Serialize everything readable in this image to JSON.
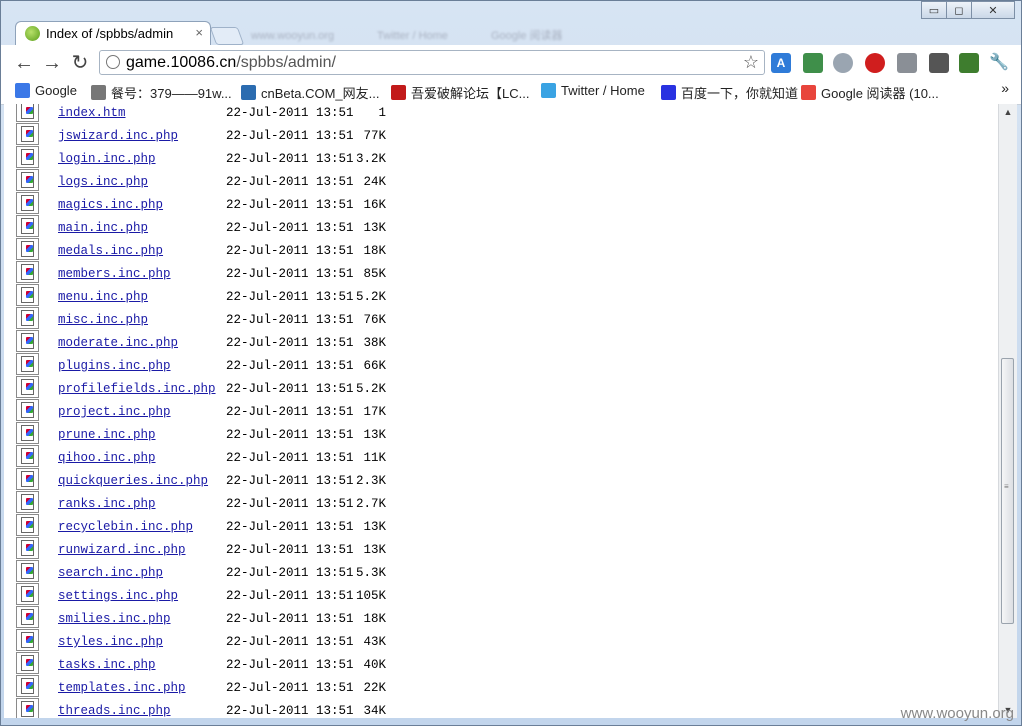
{
  "tab": {
    "title": "Index of /spbbs/admin",
    "close": "×"
  },
  "ghost_tabs": [
    "www.wooyun.org",
    "Twitter / Home",
    "Google 阅读器"
  ],
  "window_controls": {
    "minimize": "▭",
    "maximize": "◻",
    "close": "✕"
  },
  "toolbar": {
    "back": "←",
    "forward": "→",
    "reload": "↻",
    "url_host": "game.10086.cn",
    "url_path": "/spbbs/admin/",
    "star": "☆"
  },
  "bookmarks": [
    {
      "label": "Google",
      "icon": "google-icon",
      "color": "#3b78e7"
    },
    {
      "label": "餐号：379——91w...",
      "icon": "globe-icon",
      "color": "#777777"
    },
    {
      "label": "cnBeta.COM_网友...",
      "icon": "cnbeta-icon",
      "color": "#2b6cb0"
    },
    {
      "label": "吾爱破解论坛【LC...",
      "icon": "52pojie-icon",
      "color": "#c21a1a"
    },
    {
      "label": "Twitter / Home",
      "icon": "twitter-icon",
      "color": "#3aa3e3"
    },
    {
      "label": "百度一下，你就知道",
      "icon": "baidu-icon",
      "color": "#2932e1"
    },
    {
      "label": "Google 阅读器 (10...",
      "icon": "reader-icon",
      "color": "#e8453c"
    }
  ],
  "bookmarks_more": "»",
  "files": [
    {
      "name": "index.htm",
      "date": "22-Jul-2011 13:51",
      "size": "1"
    },
    {
      "name": "jswizard.inc.php",
      "date": "22-Jul-2011 13:51",
      "size": "77K"
    },
    {
      "name": "login.inc.php",
      "date": "22-Jul-2011 13:51",
      "size": "3.2K"
    },
    {
      "name": "logs.inc.php",
      "date": "22-Jul-2011 13:51",
      "size": "24K"
    },
    {
      "name": "magics.inc.php",
      "date": "22-Jul-2011 13:51",
      "size": "16K"
    },
    {
      "name": "main.inc.php",
      "date": "22-Jul-2011 13:51",
      "size": "13K"
    },
    {
      "name": "medals.inc.php",
      "date": "22-Jul-2011 13:51",
      "size": "18K"
    },
    {
      "name": "members.inc.php",
      "date": "22-Jul-2011 13:51",
      "size": "85K"
    },
    {
      "name": "menu.inc.php",
      "date": "22-Jul-2011 13:51",
      "size": "5.2K"
    },
    {
      "name": "misc.inc.php",
      "date": "22-Jul-2011 13:51",
      "size": "76K"
    },
    {
      "name": "moderate.inc.php",
      "date": "22-Jul-2011 13:51",
      "size": "38K"
    },
    {
      "name": "plugins.inc.php",
      "date": "22-Jul-2011 13:51",
      "size": "66K"
    },
    {
      "name": "profilefields.inc.php",
      "date": "22-Jul-2011 13:51",
      "size": "5.2K"
    },
    {
      "name": "project.inc.php",
      "date": "22-Jul-2011 13:51",
      "size": "17K"
    },
    {
      "name": "prune.inc.php",
      "date": "22-Jul-2011 13:51",
      "size": "13K"
    },
    {
      "name": "qihoo.inc.php",
      "date": "22-Jul-2011 13:51",
      "size": "11K"
    },
    {
      "name": "quickqueries.inc.php",
      "date": "22-Jul-2011 13:51",
      "size": "2.3K"
    },
    {
      "name": "ranks.inc.php",
      "date": "22-Jul-2011 13:51",
      "size": "2.7K"
    },
    {
      "name": "recyclebin.inc.php",
      "date": "22-Jul-2011 13:51",
      "size": "13K"
    },
    {
      "name": "runwizard.inc.php",
      "date": "22-Jul-2011 13:51",
      "size": "13K"
    },
    {
      "name": "search.inc.php",
      "date": "22-Jul-2011 13:51",
      "size": "5.3K"
    },
    {
      "name": "settings.inc.php",
      "date": "22-Jul-2011 13:51",
      "size": "105K"
    },
    {
      "name": "smilies.inc.php",
      "date": "22-Jul-2011 13:51",
      "size": "18K"
    },
    {
      "name": "styles.inc.php",
      "date": "22-Jul-2011 13:51",
      "size": "43K"
    },
    {
      "name": "tasks.inc.php",
      "date": "22-Jul-2011 13:51",
      "size": "40K"
    },
    {
      "name": "templates.inc.php",
      "date": "22-Jul-2011 13:51",
      "size": "22K"
    },
    {
      "name": "threads.inc.php",
      "date": "22-Jul-2011 13:51",
      "size": "34K"
    }
  ],
  "scrollbar": {
    "up": "▲",
    "down": "▼",
    "grip": "≡",
    "scroll_position": 0.62
  },
  "watermark": "www.wooyun.org"
}
